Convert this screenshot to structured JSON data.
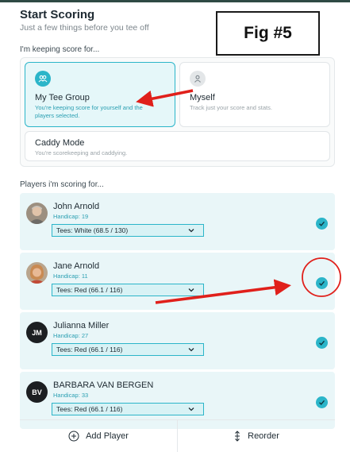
{
  "header": {
    "title": "Start Scoring",
    "subtitle": "Just a few things before you tee off"
  },
  "figure_label": "Fig #5",
  "keeping_label": "I'm keeping score for...",
  "modes": [
    {
      "title": "My Tee Group",
      "desc_line1": "You're keeping score for yourself and the",
      "desc_line2": "players selected.",
      "icon": "group-icon",
      "selected": true
    },
    {
      "title": "Myself",
      "desc_line1": "Track just your score and stats.",
      "desc_line2": "",
      "icon": "person-icon",
      "selected": false
    },
    {
      "title": "Caddy Mode",
      "desc_line1": "You're scorekeeping and caddying.",
      "desc_line2": "",
      "selected": false
    }
  ],
  "players_label": "Players i'm scoring for...",
  "players": [
    {
      "name": "John Arnold",
      "handicap": "Handicap: 19",
      "tees": "Tees:  White (68.5 / 130)",
      "avatar": "photo",
      "initials": "",
      "checked": true
    },
    {
      "name": "Jane Arnold",
      "handicap": "Handicap: 11",
      "tees": "Tees:  Red (66.1 / 116)",
      "avatar": "photo",
      "initials": "",
      "checked": true
    },
    {
      "name": "Julianna Miller",
      "handicap": "Handicap: 27",
      "tees": "Tees:  Red (66.1 / 116)",
      "avatar": "initials",
      "initials": "JM",
      "checked": true
    },
    {
      "name": "BARBARA VAN BERGEN",
      "handicap": "Handicap: 33",
      "tees": "Tees:  Red (66.1 / 116)",
      "avatar": "initials",
      "initials": "BV",
      "checked": true
    }
  ],
  "actions": {
    "add_player": "Add Player",
    "reorder": "Reorder"
  },
  "colors": {
    "accent": "#2bb5c9",
    "selected_bg": "#e5f7f9",
    "player_bg": "#e9f6f8",
    "annotation_red": "#e0201b"
  }
}
